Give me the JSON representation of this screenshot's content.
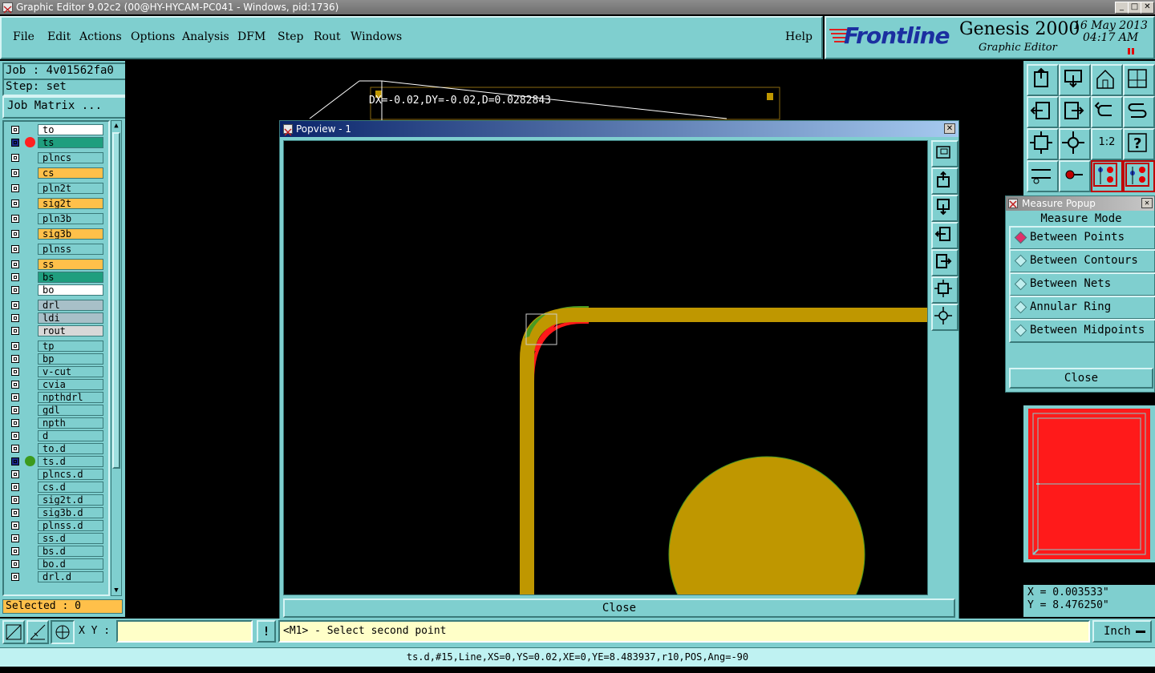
{
  "window": {
    "title": "Graphic Editor 9.02c2 (00@HY-HYCAM-PC041 - Windows, pid:1736)"
  },
  "menu": {
    "items": [
      "File",
      "Edit",
      "Actions",
      "Options",
      "Analysis",
      "DFM",
      "Step",
      "Rout",
      "Windows"
    ],
    "underlines": [
      "F",
      "E",
      "A",
      "O",
      "A",
      "D",
      "S",
      "R",
      "W"
    ],
    "help": "Help"
  },
  "brand": {
    "logo": "Frontline",
    "product": "Genesis 2000",
    "subtitle": "Graphic Editor",
    "date": "16 May 2013",
    "time": "04:17 AM"
  },
  "job": {
    "job_label": "Job : 4v01562fa0",
    "step_label": "Step: set",
    "matrix_button": "Job Matrix ..."
  },
  "layers": [
    {
      "name": "to",
      "color": "#ffffff",
      "dot": ""
    },
    {
      "name": "ts",
      "color": "#1f9e7e",
      "dot": "#ff2020"
    },
    {
      "name": "plncs",
      "color": "#7fcfcf",
      "dot": ""
    },
    {
      "name": "cs",
      "color": "#ffc04a",
      "dot": ""
    },
    {
      "name": "pln2t",
      "color": "#7fcfcf",
      "dot": ""
    },
    {
      "name": "sig2t",
      "color": "#ffc04a",
      "dot": ""
    },
    {
      "name": "pln3b",
      "color": "#7fcfcf",
      "dot": ""
    },
    {
      "name": "sig3b",
      "color": "#ffc04a",
      "dot": ""
    },
    {
      "name": "plnss",
      "color": "#7fcfcf",
      "dot": ""
    },
    {
      "name": "ss",
      "color": "#ffc04a",
      "dot": ""
    },
    {
      "name": "bs",
      "color": "#1f9e7e",
      "dot": ""
    },
    {
      "name": "bo",
      "color": "#ffffff",
      "dot": ""
    },
    {
      "name": "drl",
      "color": "#a8c0c8",
      "dot": ""
    },
    {
      "name": "ldi",
      "color": "#a8c0c8",
      "dot": ""
    },
    {
      "name": "rout",
      "color": "#d8d8d8",
      "dot": ""
    },
    {
      "name": "tp",
      "color": "#7fcfcf",
      "dot": ""
    },
    {
      "name": "bp",
      "color": "#7fcfcf",
      "dot": ""
    },
    {
      "name": "v-cut",
      "color": "#7fcfcf",
      "dot": ""
    },
    {
      "name": "cvia",
      "color": "#7fcfcf",
      "dot": ""
    },
    {
      "name": "npthdrl",
      "color": "#7fcfcf",
      "dot": ""
    },
    {
      "name": "gdl",
      "color": "#7fcfcf",
      "dot": ""
    },
    {
      "name": "npth",
      "color": "#7fcfcf",
      "dot": ""
    },
    {
      "name": "d",
      "color": "#7fcfcf",
      "dot": ""
    },
    {
      "name": "to.d",
      "color": "#7fcfcf",
      "dot": ""
    },
    {
      "name": "ts.d",
      "color": "#7fcfcf",
      "dot": "#3c9a1c"
    },
    {
      "name": "plncs.d",
      "color": "#7fcfcf",
      "dot": ""
    },
    {
      "name": "cs.d",
      "color": "#7fcfcf",
      "dot": ""
    },
    {
      "name": "sig2t.d",
      "color": "#7fcfcf",
      "dot": ""
    },
    {
      "name": "sig3b.d",
      "color": "#7fcfcf",
      "dot": ""
    },
    {
      "name": "plnss.d",
      "color": "#7fcfcf",
      "dot": ""
    },
    {
      "name": "ss.d",
      "color": "#7fcfcf",
      "dot": ""
    },
    {
      "name": "bs.d",
      "color": "#7fcfcf",
      "dot": ""
    },
    {
      "name": "bo.d",
      "color": "#7fcfcf",
      "dot": ""
    },
    {
      "name": "drl.d",
      "color": "#7fcfcf",
      "dot": ""
    }
  ],
  "selected": "Selected : 0",
  "measure_readout": "DX=-0.02,DY=-0.02,D=0.0282843",
  "popview": {
    "title": "Popview - 1",
    "close": "Close"
  },
  "measure_popup": {
    "title": "Measure Popup",
    "header": "Measure Mode",
    "options": [
      "Between Points",
      "Between Contours",
      "Between Nets",
      "Annular Ring",
      "Between Midpoints"
    ],
    "selected_index": 0,
    "close": "Close"
  },
  "coords": {
    "x": "X = 0.003533\"",
    "y": "Y = 8.476250\""
  },
  "bottom": {
    "xy_label": "X Y :",
    "xy_value": "",
    "prompt": "<M1> - Select second point",
    "units": "Inch",
    "status": "ts.d,#15,Line,XS=0,YS=0.02,XE=0,YE=8.483937,r10,POS,Ang=-90"
  },
  "colors": {
    "teal": "#7fcfcf",
    "copper": "#bf9700",
    "highlight_red": "#ff1a1a",
    "highlight_green": "#4a9a22"
  }
}
